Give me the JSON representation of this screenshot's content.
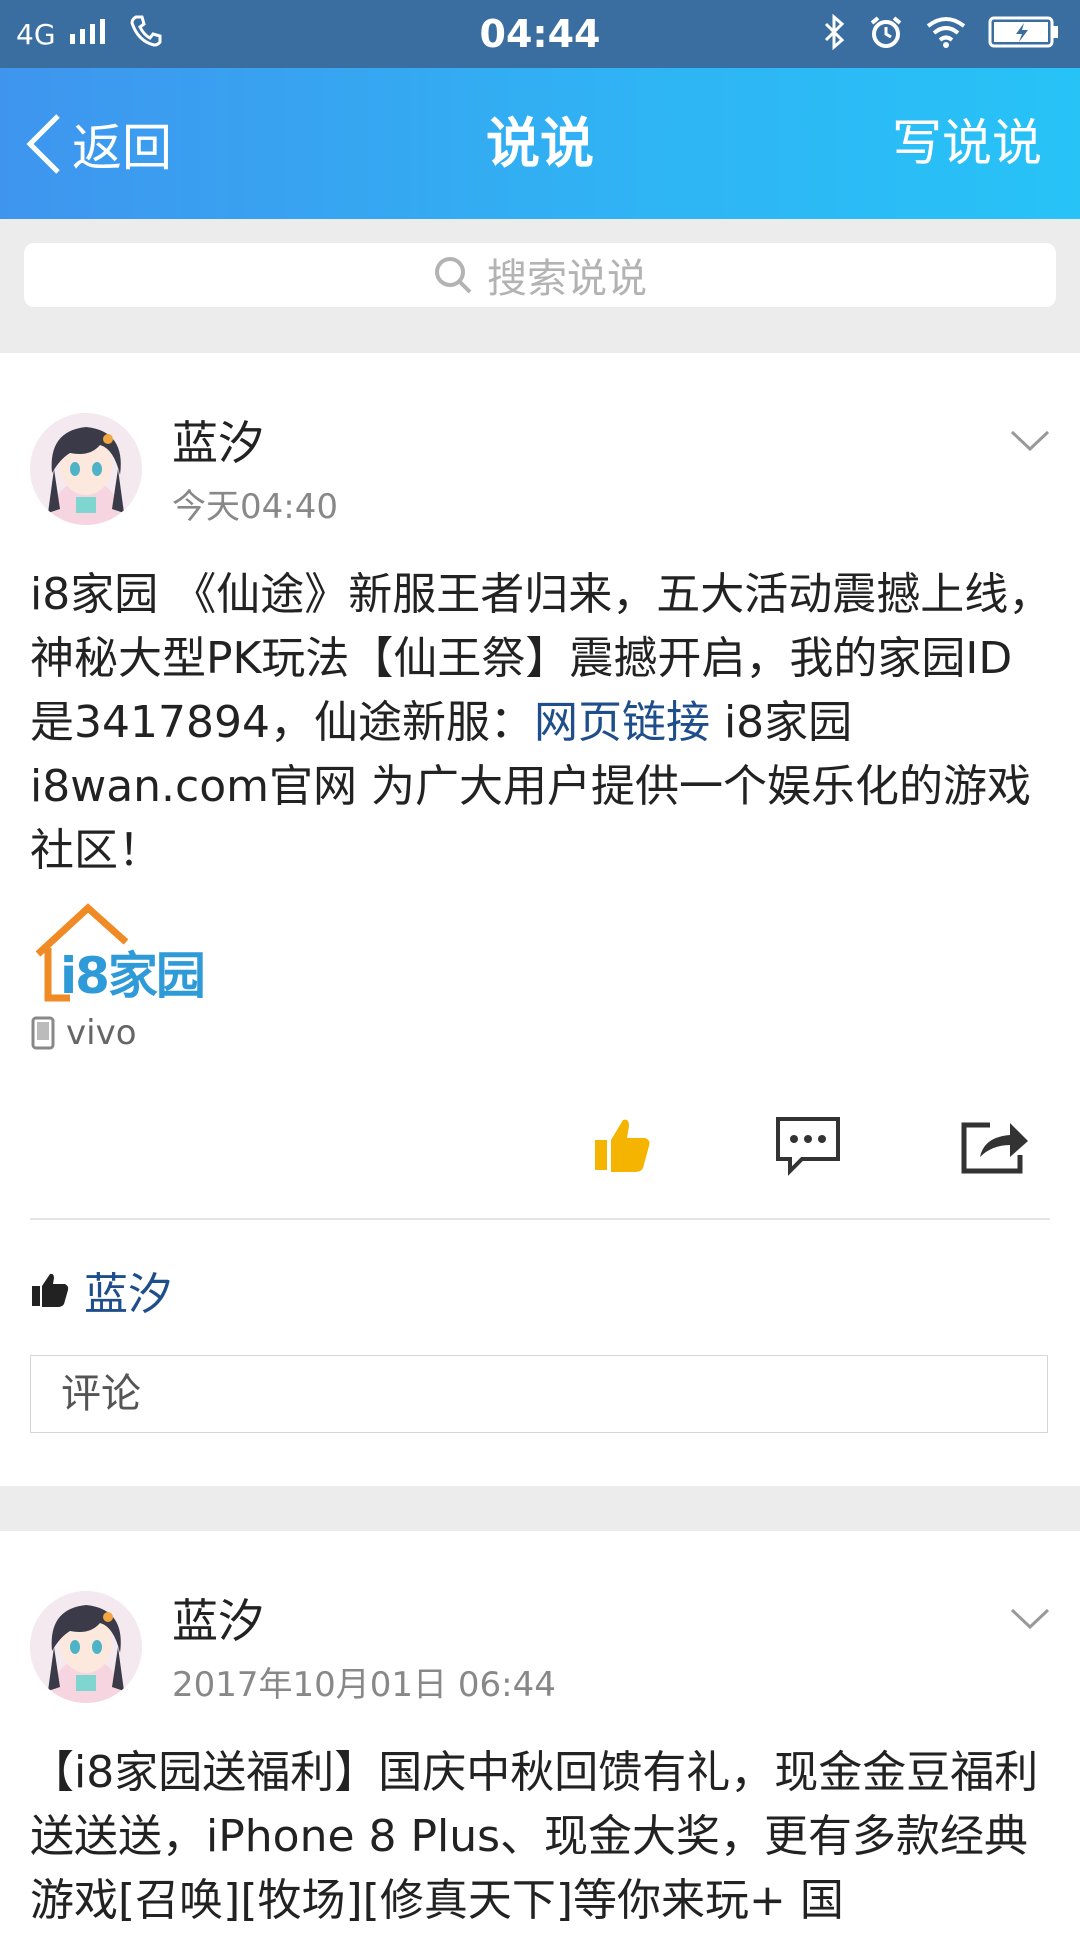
{
  "status_bar": {
    "network": "4G",
    "time": "04:44"
  },
  "nav": {
    "back_label": "返回",
    "title": "说说",
    "action_label": "写说说"
  },
  "search": {
    "placeholder": "搜索说说"
  },
  "posts": [
    {
      "author": "蓝汐",
      "time": "今天04:40",
      "text_before_link": "i8家园 《仙途》新服王者归来，五大活动震撼上线，神秘大型PK玩法【仙王祭】震撼开启，我的家园ID是3417894，仙途新服：",
      "link_text": "网页链接",
      "text_after_link": " i8家园i8wan.com官网 为广大用户提供一个娱乐化的游戏社区！",
      "image_logo_text": "i8家园",
      "device": "vivo",
      "liked_by": "蓝汐",
      "comment_placeholder": "评论"
    },
    {
      "author": "蓝汐",
      "time": "2017年10月01日 06:44",
      "text": "【i8家园送福利】国庆中秋回馈有礼，现金金豆福利送送送，iPhone 8 Plus、现金大奖，更有多款经典游戏[召唤][牧场][修真天下]等你来玩+ 国"
    }
  ],
  "colors": {
    "status_bar": "#3a6ea0",
    "nav_gradient_start": "#3f95ee",
    "nav_gradient_end": "#27c3f7",
    "link": "#1f4e8c",
    "like_active": "#f5b400"
  }
}
